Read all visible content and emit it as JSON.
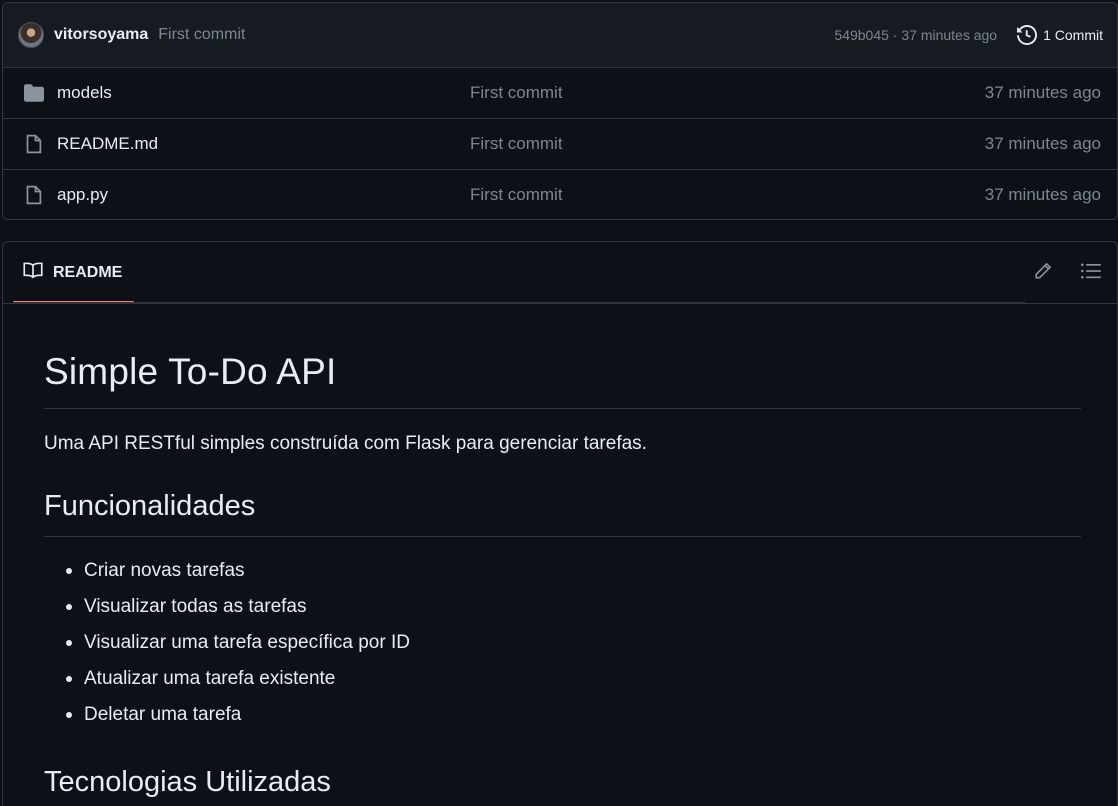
{
  "commit": {
    "author": "vitorsoyama",
    "message": "First commit",
    "sha_time": "549b045 · 37 minutes ago",
    "commits_label": "1 Commit"
  },
  "files": [
    {
      "name": "models",
      "type": "folder",
      "message": "First commit",
      "time": "37 minutes ago"
    },
    {
      "name": "README.md",
      "type": "file",
      "message": "First commit",
      "time": "37 minutes ago"
    },
    {
      "name": "app.py",
      "type": "file",
      "message": "First commit",
      "time": "37 minutes ago"
    }
  ],
  "readme": {
    "tab_label": "README",
    "title": "Simple To-Do API",
    "description": "Uma API RESTful simples construída com Flask para gerenciar tarefas.",
    "section1_title": "Funcionalidades",
    "features": [
      "Criar novas tarefas",
      "Visualizar todas as tarefas",
      "Visualizar uma tarefa específica por ID",
      "Atualizar uma tarefa existente",
      "Deletar uma tarefa"
    ],
    "section2_title": "Tecnologias Utilizadas"
  },
  "colors": {
    "background": "#0d1117",
    "header_bg": "#161b22",
    "border": "#30363d",
    "muted_text": "#7d8590",
    "tab_accent": "#f78166"
  },
  "icons": {
    "folder": "folder-icon",
    "file": "file-icon",
    "history": "history-icon",
    "book": "book-icon",
    "edit": "pencil-icon",
    "outline": "list-icon"
  }
}
